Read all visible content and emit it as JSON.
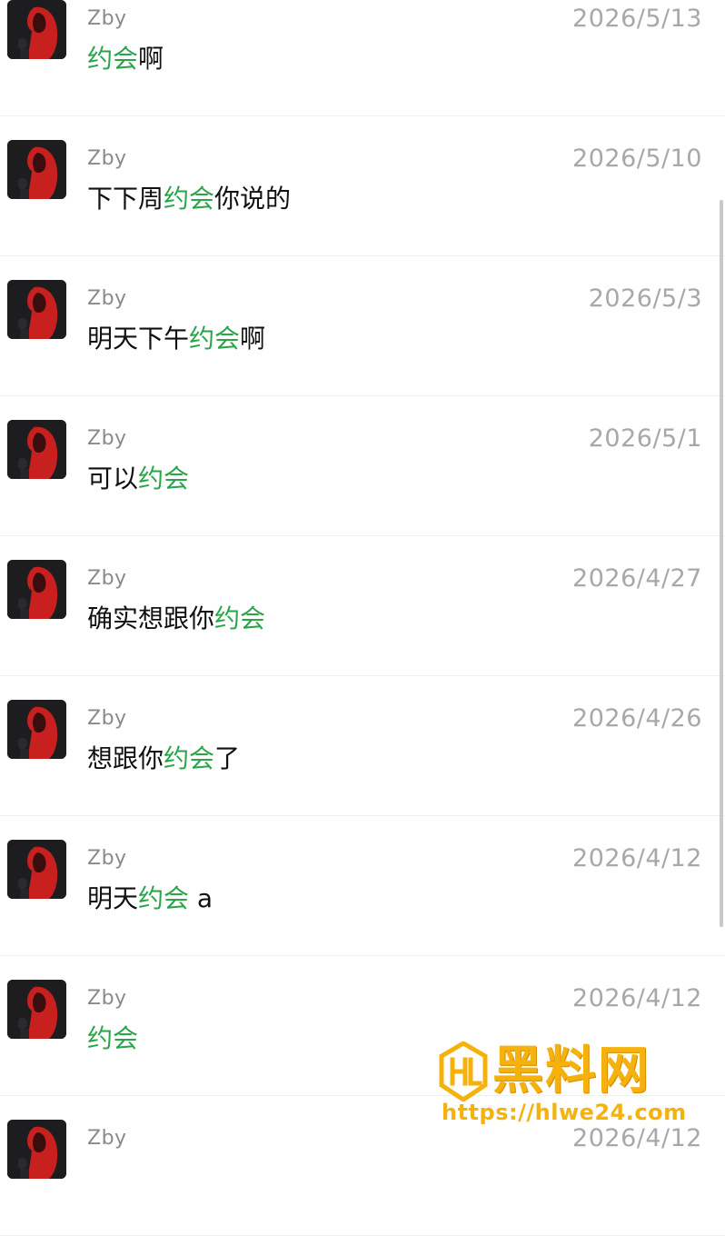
{
  "results": [
    {
      "sender": "Zby",
      "date": "2026/5/13",
      "segments": [
        {
          "t": "约会",
          "hl": true
        },
        {
          "t": "啊",
          "hl": false
        }
      ]
    },
    {
      "sender": "Zby",
      "date": "2026/5/10",
      "segments": [
        {
          "t": "下下周",
          "hl": false
        },
        {
          "t": "约会",
          "hl": true
        },
        {
          "t": "你说的",
          "hl": false
        }
      ]
    },
    {
      "sender": "Zby",
      "date": "2026/5/3",
      "segments": [
        {
          "t": "明天下午",
          "hl": false
        },
        {
          "t": "约会",
          "hl": true
        },
        {
          "t": "啊",
          "hl": false
        }
      ]
    },
    {
      "sender": "Zby",
      "date": "2026/5/1",
      "segments": [
        {
          "t": "可以",
          "hl": false
        },
        {
          "t": "约会",
          "hl": true
        }
      ]
    },
    {
      "sender": "Zby",
      "date": "2026/4/27",
      "segments": [
        {
          "t": "确实想跟你",
          "hl": false
        },
        {
          "t": "约会",
          "hl": true
        }
      ]
    },
    {
      "sender": "Zby",
      "date": "2026/4/26",
      "segments": [
        {
          "t": "想跟你",
          "hl": false
        },
        {
          "t": "约会",
          "hl": true
        },
        {
          "t": "了",
          "hl": false
        }
      ]
    },
    {
      "sender": "Zby",
      "date": "2026/4/12",
      "segments": [
        {
          "t": "明天",
          "hl": false
        },
        {
          "t": "约会",
          "hl": true
        },
        {
          "t": " a",
          "hl": false
        }
      ]
    },
    {
      "sender": "Zby",
      "date": "2026/4/12",
      "segments": [
        {
          "t": "约会",
          "hl": true
        }
      ]
    },
    {
      "sender": "Zby",
      "date": "2026/4/12",
      "segments": []
    }
  ],
  "watermark": {
    "title": "黑料网",
    "url": "https://hlwe24.com"
  },
  "colors": {
    "highlight": "#2aa449",
    "sender": "#8a8a8a",
    "date": "#a8a8a8",
    "message": "#111111",
    "avatar_bg": "#1d1d1f",
    "avatar_figure": "#c8201f",
    "watermark": "#f5b10c"
  },
  "icons": {
    "avatar": "avatar-red-hood-figure",
    "watermark_logo": "hl-shield-logo"
  }
}
